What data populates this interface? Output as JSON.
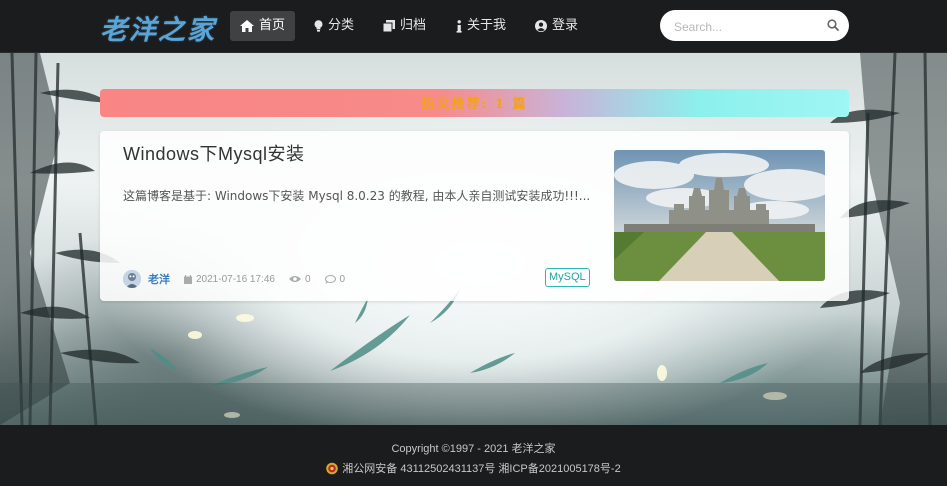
{
  "site": {
    "logo": "老洋之家"
  },
  "nav": {
    "items": [
      {
        "label": "首页",
        "icon": "home-icon",
        "active": true
      },
      {
        "label": "分类",
        "icon": "lightbulb-icon",
        "active": false
      },
      {
        "label": "归档",
        "icon": "clone-icon",
        "active": false
      },
      {
        "label": "关于我",
        "icon": "info-icon",
        "active": false
      },
      {
        "label": "登录",
        "icon": "user-circle-icon",
        "active": false
      }
    ],
    "search_placeholder": "Search...",
    "search_icon": "search-icon"
  },
  "hot": {
    "text": "热文推荐: 1 篇"
  },
  "post": {
    "title": "Windows下Mysql安装",
    "excerpt": "这篇博客是基于: Windows下安装 Mysql 8.0.23 的教程, 由本人亲自测试安装成功!!!...",
    "author": "老洋",
    "date": "2021-07-16 17:46",
    "views": "0",
    "comments": "0",
    "tag": "MySQL"
  },
  "footer": {
    "copyright": "Copyright ©1997 - 2021 老洋之家",
    "icp": "湘公网安备 43112502431137号 湘ICP备2021005178号-2"
  },
  "colors": {
    "navbar_bg": "#1b1c1d",
    "logo": "#5aa5d8",
    "banner_left": "#f98585",
    "banner_right": "#9ff6f3",
    "banner_text": "#f2a21b",
    "author": "#3b7fc1",
    "tag": "#1fa39d"
  }
}
